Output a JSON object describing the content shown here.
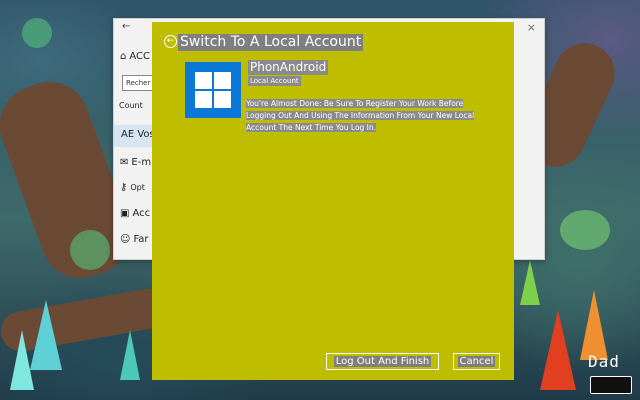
{
  "dialog": {
    "title": "Switch To A Local Account",
    "account_name": "PhonAndroid",
    "account_type": "Local Account",
    "message": "You're Almost Done: Be Sure To Register Your Work Before Logging Out And Using The Information From Your New Local Account The Next Time You Log In.",
    "finish_label": "Log Out And Finish",
    "cancel_label": "Cancel",
    "tile_color": "#0a78d7",
    "background_color": "#bfbd00"
  },
  "settings_window": {
    "back_glyph": "←",
    "close_glyph": "×",
    "home_label": "ACC",
    "search_placeholder": "Recher",
    "section_label": "Count",
    "items": [
      {
        "label": "AE Vos",
        "icon": "person-icon"
      },
      {
        "label": "E-m",
        "icon": "mail-icon"
      },
      {
        "label": "Opt",
        "icon": "key-icon"
      },
      {
        "label": "Acc",
        "icon": "briefcase-icon"
      },
      {
        "label": "Far",
        "icon": "family-icon"
      }
    ]
  },
  "watermark": {
    "text": "Dad"
  }
}
